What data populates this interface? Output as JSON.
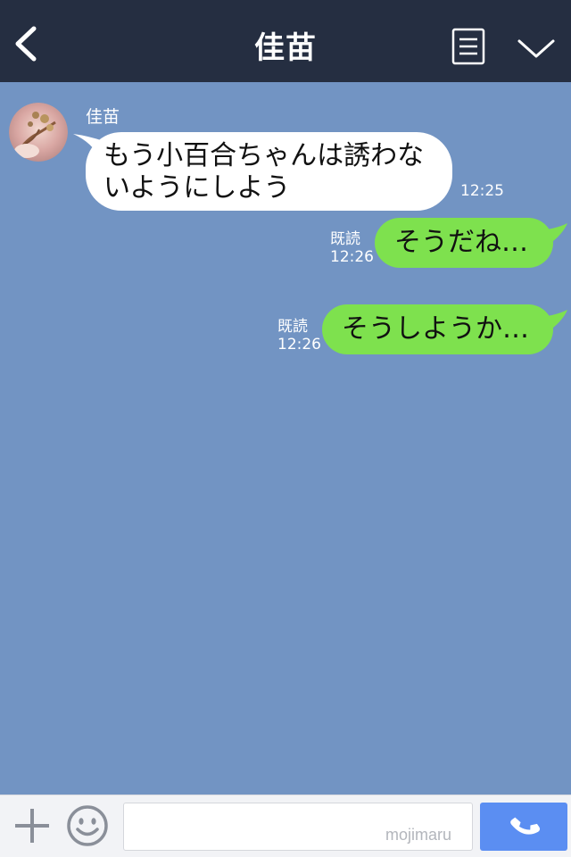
{
  "header": {
    "title": "佳苗",
    "back_icon": "chevron-left-icon",
    "menu_icon": "menu-icon",
    "collapse_icon": "chevron-down-icon",
    "background": "#252e41"
  },
  "chat": {
    "background": "#7294c3",
    "messages": [
      {
        "direction": "incoming",
        "sender": "佳苗",
        "lines": [
          "もう小百合ちゃんは誘わな",
          "いようにしよう"
        ],
        "time": "12:25"
      },
      {
        "direction": "outgoing",
        "text": "そうだね…",
        "read": "既読",
        "time": "12:26"
      },
      {
        "direction": "outgoing",
        "text": "そうしようか…",
        "read": "既読",
        "time": "12:26"
      }
    ]
  },
  "input_bar": {
    "plus_icon": "plus-icon",
    "emoji_icon": "smiley-icon",
    "placeholder": "",
    "watermark": "mojimaru",
    "call_icon": "phone-icon"
  },
  "colors": {
    "outgoing_bubble": "#7ee14e",
    "incoming_bubble": "#ffffff",
    "call_button": "#5b8ef2"
  }
}
